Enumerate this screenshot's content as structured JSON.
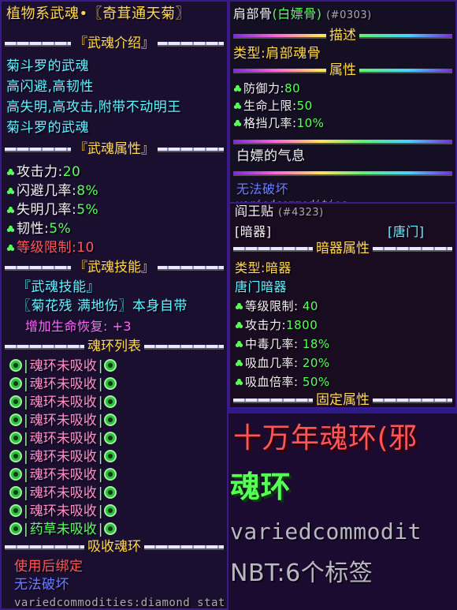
{
  "left": {
    "title": "植物系武魂•〖奇茸通天菊〗",
    "sec_intro": "『武魂介绍』",
    "intro_lines": [
      "菊斗罗的武魂",
      "高闪避,高韧性",
      "高失明,高攻击,附带不动明王",
      "菊斗罗的武魂"
    ],
    "sec_attr": "『武魂属性』",
    "attrs": [
      {
        "label": "攻击力:",
        "value": "20"
      },
      {
        "label": "闪避几率:",
        "value": "8%"
      },
      {
        "label": "失明几率:",
        "value": "5%"
      },
      {
        "label": "韧性:",
        "value": "5%"
      }
    ],
    "level_limit": {
      "label": "等级限制:",
      "value": "10"
    },
    "sec_skill": "『武魂技能』",
    "skill_header": "『武魂技能』",
    "skill_line": "〖菊花残 满地伤〗本身自带",
    "skill_effect": "增加生命恢复: +3",
    "sec_rings": "魂环列表",
    "rings": [
      "魂环未吸收",
      "魂环未吸收",
      "魂环未吸收",
      "魂环未吸收",
      "魂环未吸收",
      "魂环未吸收",
      "魂环未吸收",
      "魂环未吸收",
      "魂环未吸收",
      "药草未吸收"
    ],
    "sec_absorb": "吸收魂环",
    "bind_text": "使用后绑定",
    "unbreakable": "无法破坏",
    "item_id": "variedcommodities:diamond_stat"
  },
  "bone": {
    "title": "肩部骨",
    "title_name": "(白嫖骨)",
    "title_id": "(#0303)",
    "sec_desc": "描述",
    "type_line": "类型:肩部魂骨",
    "sec_attr": "属性",
    "attrs": [
      {
        "label": "防御力:",
        "value": "80"
      },
      {
        "label": "生命上限:",
        "value": "50"
      },
      {
        "label": "格挡几率:",
        "value": "10%"
      }
    ],
    "flavor": "白嫖的气息",
    "unbreakable": "无法破坏",
    "cut_text": "variedcommodities:"
  },
  "weapon": {
    "title": "阎王贴",
    "title_id": "(#4323)",
    "tag_left": "[暗器]",
    "tag_right": "[唐门]",
    "sec_attr": "暗器属性",
    "type_line": "类型:暗器",
    "sub_line": "唐门暗器",
    "attrs": [
      {
        "label": "等级限制:",
        "value": "40"
      },
      {
        "label": "攻击力:",
        "value": "1800"
      },
      {
        "label": "中毒几率:",
        "value": "18%"
      },
      {
        "label": "吸血几率:",
        "value": "20%"
      },
      {
        "label": "吸血倍率:",
        "value": "50%"
      }
    ],
    "sec_fixed": "固定属性"
  },
  "ring": {
    "title": "十万年魂环(邪",
    "sub": "魂环",
    "item_id": "variedcommodit",
    "nbt": "NBT:6个标签"
  }
}
